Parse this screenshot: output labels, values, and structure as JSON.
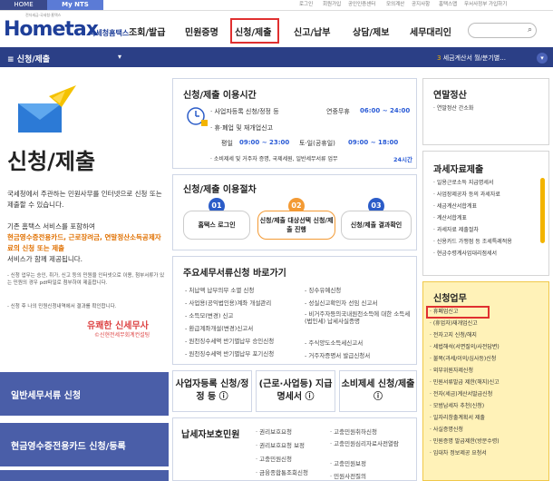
{
  "topbar": {
    "home": "HOME",
    "mynts": "My NTS",
    "links": [
      "로그인",
      "회원가입",
      "공인인증센터",
      "모의계산",
      "공지사항",
      "홈택스맵",
      "무서사정부 가입하기"
    ]
  },
  "gnb": {
    "logo": "Hometax",
    "logo_sub": "국세청홈택스",
    "logo_small": "전자세금·국세청·홈택스",
    "menus": [
      "조회/발급",
      "민원증명",
      "신청/제출",
      "신고/납부",
      "상담/제보",
      "세무대리인"
    ],
    "search_icon": "search-icon"
  },
  "subnav": {
    "title": "≡  신청/제출",
    "arrow": "▾",
    "notice": "세금계산서 월/분기별...",
    "notice_num": "3",
    "circle": "▾"
  },
  "hero": {
    "title": "신청/제출",
    "desc": "국세청에서 주관하는 민원사무를 인터넷으로 신청 또는 제출할 수 있습니다.",
    "desc2_a": "기존 홈택스 서비스를 포함하여",
    "desc2_b": "현금영수증전용카드, 근로장려금, 연말정산소득공제자료의 신청 또는 제출",
    "desc2_c": "서비스가 함께 제공됩니다.",
    "bullet1": "- 신청 업무는 승인, 취가, 신고 등의 민원을 인터넷으로 이용, 첨부서류가 있는 민원의 경우 pdf파일로 첨부하여 제출합니다.",
    "bullet2": "- 신청 후 나의 민원신청내역에서 결과를 확인합니다.",
    "seal": "유쾌한 신세무사",
    "seal_sub": "©신현전세무회계컨설팅"
  },
  "hours": {
    "title": "신청/제출 이용시간",
    "r1a": "· 사업자등록 신청/정정 등",
    "r1b": "연중무휴",
    "r1c": "06:00 ~ 24:00",
    "r2": "· 휴·폐업 및 재개업신고",
    "r3a": "평일",
    "r3b": "09:00 ~ 23:00",
    "r3c": "토·일(공휴일)",
    "r3d": "09:00 ~ 18:00",
    "r4a": "· 소비제세 및 거주자 증명, 국제세원, 일반세무서류 업무",
    "r4b": "24시간"
  },
  "steps": {
    "title": "신청/제출 이용절차",
    "items": [
      {
        "num": "01",
        "label": "홈택스 로그인"
      },
      {
        "num": "02",
        "label": "신청/제출 대상선택 신청/제출 진행"
      },
      {
        "num": "03",
        "label": "신청/제출 결과확인"
      }
    ]
  },
  "docs": {
    "title": "주요세무서류신청 바로가기",
    "left": [
      "- 처납액 납부의무 소멸 신청",
      "- 사업용(공익법인용)계좌 개설관리",
      "- 소득모(변경) 신고",
      "- 환급계좌개설(변경)신고서",
      "- 원천징수세액 반기별납부 승인신청",
      "- 원천징수세액 반기별납부 포기신청"
    ],
    "right": [
      "- 징수유예신청",
      "- 성실신고확인자 선임 신고서",
      "- 비거주자등의국내원천소득에 대한 소득세(법인세) 납세사실증명",
      "- 주식양도소득세신고서",
      "- 거주자증명서 발급신청서"
    ]
  },
  "mini": [
    "사업자등록 신청/정정 등 ⓘ",
    "(근로·사업등) 지급명세서 ⓘ",
    "소비제세 신청/제출 ⓘ"
  ],
  "petition": {
    "title": "납세자보호민원",
    "col1": [
      "· 권리보호요청",
      "· 권리보호요청 보정",
      "· 고충민원신청",
      "· 금융종합통조회신청"
    ],
    "col2": [
      "· 고충민원취하신청",
      "· 고충민원심리자료사전열람",
      "· 고충민원보정",
      "· 민원사전질의"
    ]
  },
  "leftbtns": [
    "일반세무서류 신청",
    "현금영수증전용카드 신청/등록"
  ],
  "year_end": {
    "title": "연말정산",
    "items": [
      "· 연말정산 간소화"
    ]
  },
  "tax_submit": {
    "title": "과세자료제출",
    "items": [
      "· 일용근로소득 지급명세서",
      "· 사업장제공자 등의 과세자료",
      "· 세금계산서합계표",
      "· 계산서합계표",
      "· 과세자료 제출절차",
      "· 신용카드 가맹점 등 조세특례적용",
      "· 현금수령계사업대리점세서"
    ]
  },
  "apply": {
    "title": "신청업무",
    "items": [
      "· 휴폐업신고",
      "· (휴업자)재개업신고",
      "· 전자고지 신청/해지",
      "· 세법해석(서면질의/사전답변)",
      "· 불복(과세/이의/심사등)신청",
      "· 외부위원자제신청",
      "· 민원서류발급 제한(해지)신고",
      "· 전자(세금)계산서발급신청",
      "· 모범납세자 추천(신청)",
      "· 일자리창출계획서 제출",
      "· 사실증명신청",
      "· 민원증명 발급제한(방문수령)",
      "· 임대차 정보제공 요청서"
    ]
  }
}
